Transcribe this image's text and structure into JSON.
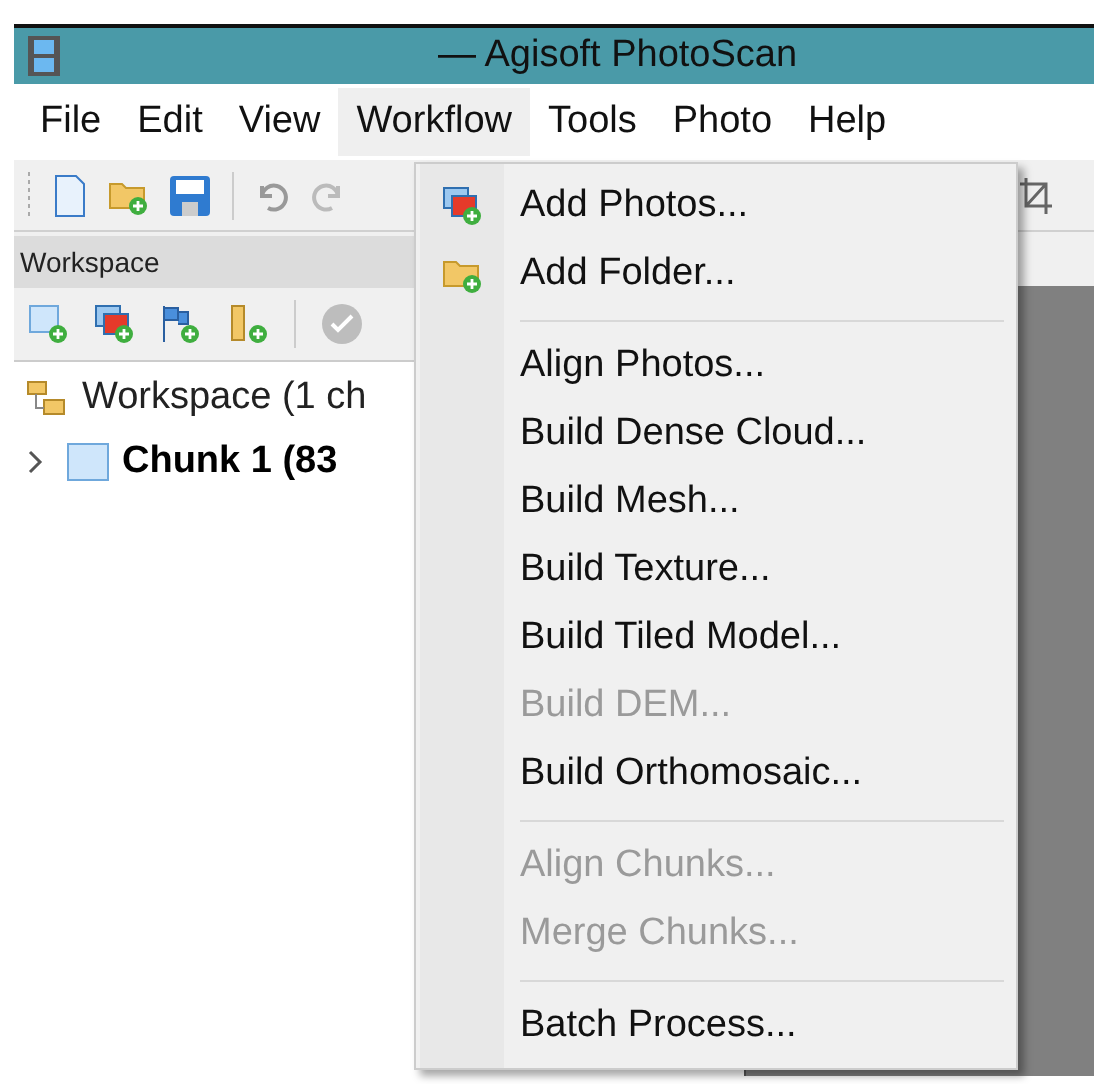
{
  "window": {
    "title": "— Agisoft PhotoScan"
  },
  "menubar": [
    {
      "label": "File",
      "selected": false
    },
    {
      "label": "Edit",
      "selected": false
    },
    {
      "label": "View",
      "selected": false
    },
    {
      "label": "Workflow",
      "selected": true
    },
    {
      "label": "Tools",
      "selected": false
    },
    {
      "label": "Photo",
      "selected": false
    },
    {
      "label": "Help",
      "selected": false
    }
  ],
  "workspace_panel": {
    "title": "Workspace",
    "tree": [
      {
        "label": "Workspace (1 ch",
        "kind": "workspace",
        "children": [
          {
            "label": "Chunk 1 (83",
            "kind": "chunk",
            "expanded": false
          }
        ]
      }
    ]
  },
  "workflow_menu": [
    {
      "kind": "item",
      "label": "Add Photos...",
      "disabled": false
    },
    {
      "kind": "item",
      "label": "Add Folder...",
      "disabled": false
    },
    {
      "kind": "separator"
    },
    {
      "kind": "item",
      "label": "Align Photos...",
      "disabled": false
    },
    {
      "kind": "item",
      "label": "Build Dense Cloud...",
      "disabled": false
    },
    {
      "kind": "item",
      "label": "Build Mesh...",
      "disabled": false
    },
    {
      "kind": "item",
      "label": "Build Texture...",
      "disabled": false
    },
    {
      "kind": "item",
      "label": "Build Tiled Model...",
      "disabled": false
    },
    {
      "kind": "item",
      "label": "Build DEM...",
      "disabled": true
    },
    {
      "kind": "item",
      "label": "Build Orthomosaic...",
      "disabled": false
    },
    {
      "kind": "separator"
    },
    {
      "kind": "item",
      "label": "Align Chunks...",
      "disabled": true
    },
    {
      "kind": "item",
      "label": "Merge Chunks...",
      "disabled": true
    },
    {
      "kind": "separator"
    },
    {
      "kind": "item",
      "label": "Batch Process...",
      "disabled": false
    }
  ]
}
